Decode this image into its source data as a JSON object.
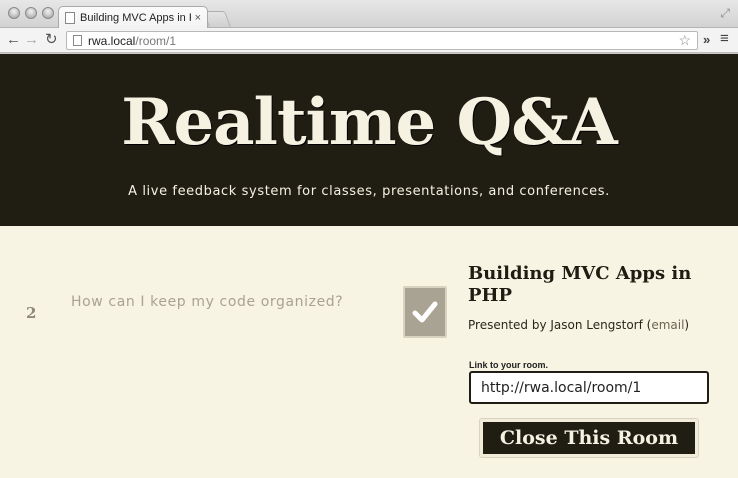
{
  "browser": {
    "tab_title": "Building MVC Apps in PHP",
    "tab_title_fade": "| b",
    "tab_close": "×",
    "url_host": "rwa.local",
    "url_path": "/room/1",
    "star_icon": "☆",
    "extensions": "»",
    "menu": "≡"
  },
  "header": {
    "title": "Realtime Q&A",
    "tagline": "A live feedback system for classes, presentations, and conferences."
  },
  "questions": [
    {
      "votes": "2",
      "text": "How can I keep my code organized?"
    }
  ],
  "room": {
    "title": "Building MVC Apps in PHP",
    "presented_by": "Presented by Jason Lengstorf (",
    "email_label": "email",
    "presented_by_end": ")",
    "link_label": "Link to your room.",
    "link_value": "http://rwa.local/room/1",
    "close_button": "Close This Room"
  },
  "colors": {
    "header_bg": "#201d13",
    "page_bg": "#f7f4e4",
    "text_light": "#f6f2e2",
    "muted": "#a8a392"
  }
}
